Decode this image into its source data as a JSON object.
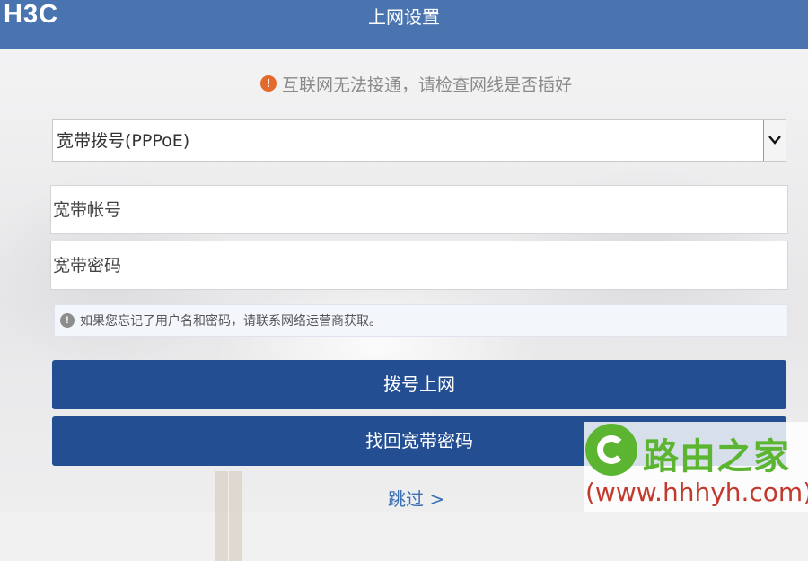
{
  "header": {
    "logo": "H3C",
    "title": "上网设置"
  },
  "warning": {
    "icon": "exclamation-icon",
    "color": "#e46a2c",
    "text": "互联网无法接通，请检查网线是否插好"
  },
  "connection_type": {
    "selected": "宽带拨号(PPPoE)"
  },
  "fields": {
    "account_placeholder": "宽带帐号",
    "password_placeholder": "宽带密码"
  },
  "hint": {
    "icon": "exclamation-icon",
    "text": "如果您忘记了用户名和密码，请联系网络运营商获取。"
  },
  "buttons": {
    "dial_label": "拨号上网",
    "recover_label": "找回宽带密码",
    "color": "#234e91"
  },
  "skip_label": "跳过 >",
  "watermark": {
    "name": "路由之家",
    "url": "(www.hhhyh.com)"
  },
  "colors": {
    "header": "#4a74b0",
    "link": "#3b6fb6"
  }
}
